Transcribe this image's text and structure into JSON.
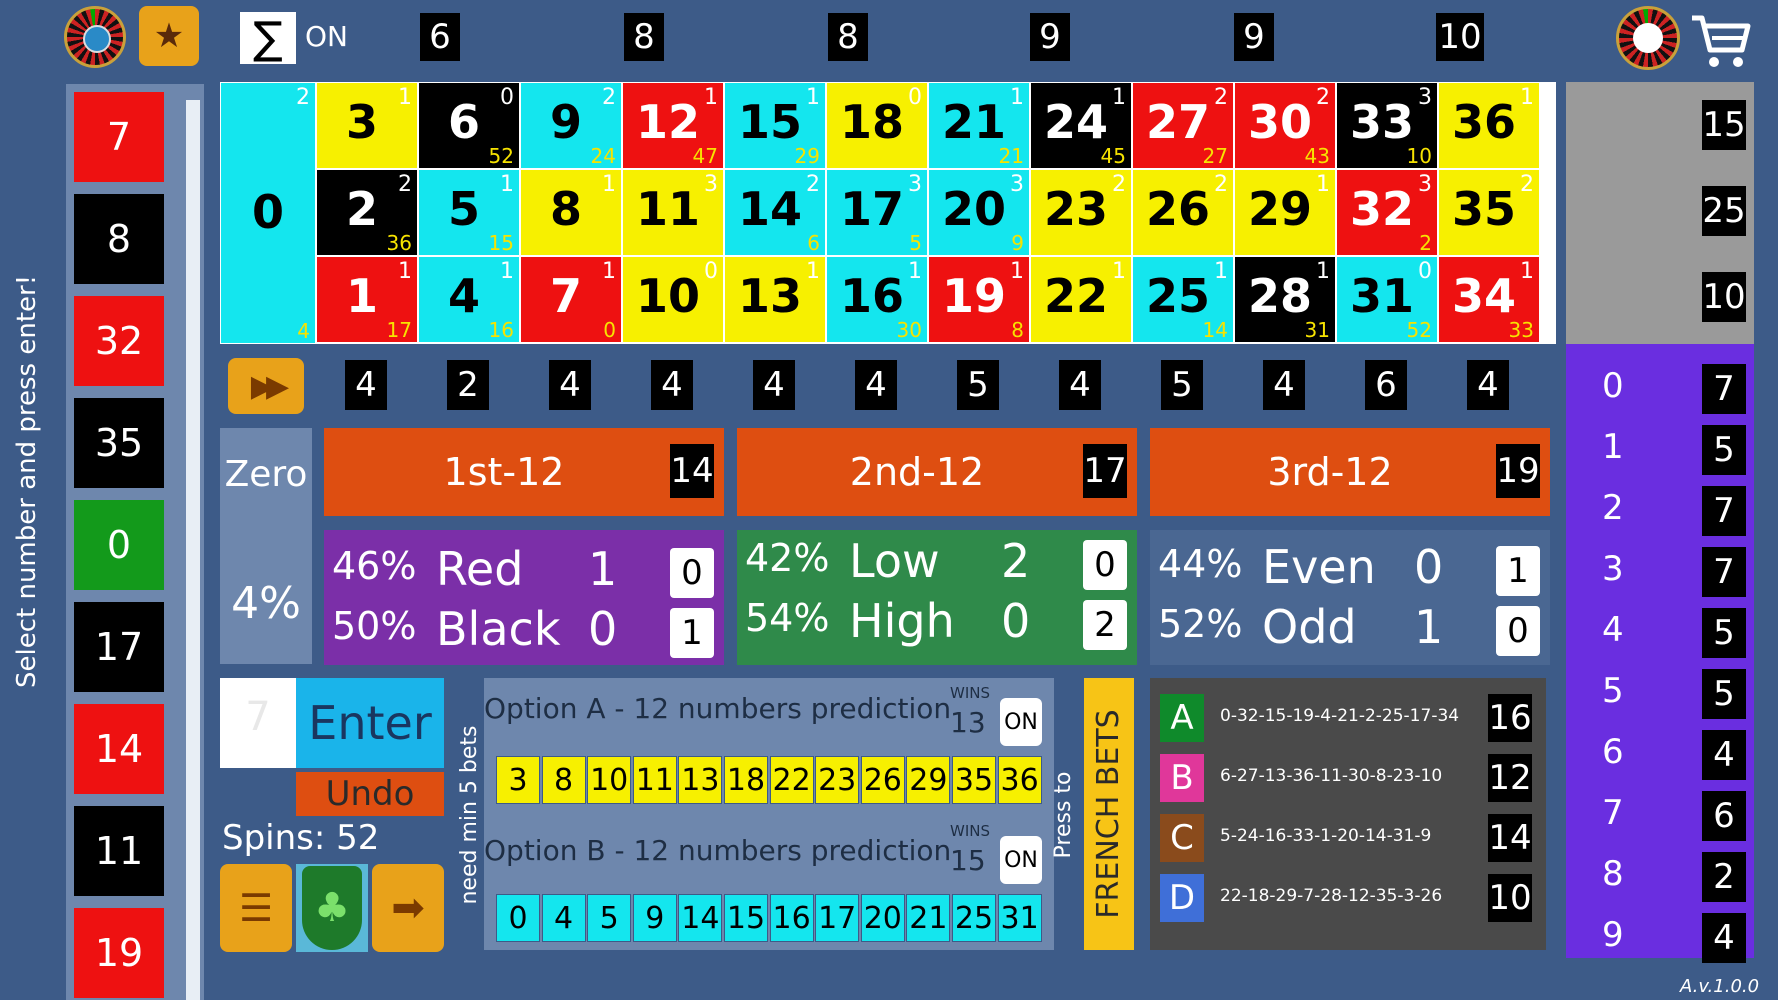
{
  "side_instruction": "Select number and press enter!",
  "history": [
    {
      "n": "7",
      "c": "red"
    },
    {
      "n": "8",
      "c": "black"
    },
    {
      "n": "32",
      "c": "red"
    },
    {
      "n": "35",
      "c": "black"
    },
    {
      "n": "0",
      "c": "green"
    },
    {
      "n": "17",
      "c": "black"
    },
    {
      "n": "14",
      "c": "red"
    },
    {
      "n": "11",
      "c": "black"
    },
    {
      "n": "19",
      "c": "red"
    }
  ],
  "topbar": {
    "sum_symbol": "∑",
    "sum_state": "ON",
    "counts": [
      "6",
      "8",
      "8",
      "9",
      "9",
      "10"
    ]
  },
  "grid": {
    "zero": {
      "n": "0",
      "sup": "2",
      "sub": "4"
    },
    "rows": [
      [
        {
          "n": "3",
          "sup": "1",
          "sub": "",
          "c": "yellow"
        },
        {
          "n": "6",
          "sup": "0",
          "sub": "52",
          "c": "black"
        },
        {
          "n": "9",
          "sup": "2",
          "sub": "24",
          "c": "cyan"
        },
        {
          "n": "12",
          "sup": "1",
          "sub": "47",
          "c": "red"
        },
        {
          "n": "15",
          "sup": "1",
          "sub": "29",
          "c": "cyan"
        },
        {
          "n": "18",
          "sup": "0",
          "sub": "",
          "c": "yellow"
        },
        {
          "n": "21",
          "sup": "1",
          "sub": "21",
          "c": "cyan"
        },
        {
          "n": "24",
          "sup": "1",
          "sub": "45",
          "c": "black"
        },
        {
          "n": "27",
          "sup": "2",
          "sub": "27",
          "c": "red"
        },
        {
          "n": "30",
          "sup": "2",
          "sub": "43",
          "c": "red"
        },
        {
          "n": "33",
          "sup": "3",
          "sub": "10",
          "c": "black"
        },
        {
          "n": "36",
          "sup": "1",
          "sub": "",
          "c": "yellow"
        }
      ],
      [
        {
          "n": "2",
          "sup": "2",
          "sub": "36",
          "c": "black"
        },
        {
          "n": "5",
          "sup": "1",
          "sub": "15",
          "c": "cyan"
        },
        {
          "n": "8",
          "sup": "1",
          "sub": "",
          "c": "yellow"
        },
        {
          "n": "11",
          "sup": "3",
          "sub": "",
          "c": "yellow"
        },
        {
          "n": "14",
          "sup": "2",
          "sub": "6",
          "c": "cyan"
        },
        {
          "n": "17",
          "sup": "3",
          "sub": "5",
          "c": "cyan"
        },
        {
          "n": "20",
          "sup": "3",
          "sub": "9",
          "c": "cyan"
        },
        {
          "n": "23",
          "sup": "2",
          "sub": "",
          "c": "yellow"
        },
        {
          "n": "26",
          "sup": "2",
          "sub": "",
          "c": "yellow"
        },
        {
          "n": "29",
          "sup": "1",
          "sub": "",
          "c": "yellow"
        },
        {
          "n": "32",
          "sup": "3",
          "sub": "2",
          "c": "red"
        },
        {
          "n": "35",
          "sup": "2",
          "sub": "",
          "c": "yellow"
        }
      ],
      [
        {
          "n": "1",
          "sup": "1",
          "sub": "17",
          "c": "red"
        },
        {
          "n": "4",
          "sup": "1",
          "sub": "16",
          "c": "cyan"
        },
        {
          "n": "7",
          "sup": "1",
          "sub": "0",
          "c": "red"
        },
        {
          "n": "10",
          "sup": "0",
          "sub": "",
          "c": "yellow"
        },
        {
          "n": "13",
          "sup": "1",
          "sub": "",
          "c": "yellow"
        },
        {
          "n": "16",
          "sup": "1",
          "sub": "30",
          "c": "cyan"
        },
        {
          "n": "19",
          "sup": "1",
          "sub": "8",
          "c": "red"
        },
        {
          "n": "22",
          "sup": "1",
          "sub": "",
          "c": "yellow"
        },
        {
          "n": "25",
          "sup": "1",
          "sub": "14",
          "c": "cyan"
        },
        {
          "n": "28",
          "sup": "1",
          "sub": "31",
          "c": "black"
        },
        {
          "n": "31",
          "sup": "0",
          "sub": "52",
          "c": "cyan"
        },
        {
          "n": "34",
          "sup": "1",
          "sub": "33",
          "c": "red"
        }
      ]
    ],
    "column_counts": [
      "15",
      "25",
      "10"
    ]
  },
  "street_counts": [
    "4",
    "2",
    "4",
    "4",
    "4",
    "4",
    "5",
    "4",
    "5",
    "4",
    "6",
    "4"
  ],
  "dozens": {
    "zero_label": "Zero",
    "zero_pct": "4%",
    "items": [
      {
        "label": "1st-12",
        "count": "14"
      },
      {
        "label": "2nd-12",
        "count": "17"
      },
      {
        "label": "3rd-12",
        "count": "19"
      }
    ]
  },
  "even_bets": [
    {
      "rows": [
        {
          "pct": "46%",
          "name": "Red",
          "val": "1",
          "box": "0"
        },
        {
          "pct": "50%",
          "name": "Black",
          "val": "0",
          "box": "1"
        }
      ]
    },
    {
      "rows": [
        {
          "pct": "42%",
          "name": "Low",
          "val": "2",
          "box": "0"
        },
        {
          "pct": "54%",
          "name": "High",
          "val": "0",
          "box": "2"
        }
      ]
    },
    {
      "rows": [
        {
          "pct": "44%",
          "name": "Even",
          "val": "0",
          "box": "1"
        },
        {
          "pct": "52%",
          "name": "Odd",
          "val": "1",
          "box": "0"
        }
      ]
    }
  ],
  "entry": {
    "input_value": "7",
    "enter_label": "Enter",
    "undo_label": "Undo",
    "spins_label": "Spins: 52"
  },
  "min_bets_note": "need min 5 bets",
  "options": [
    {
      "title": "Option A - 12 numbers prediction",
      "wins_label": "WINS",
      "wins": "13",
      "state": "ON",
      "numbers": [
        "3",
        "8",
        "10",
        "11",
        "13",
        "18",
        "22",
        "23",
        "26",
        "29",
        "35",
        "36"
      ],
      "color": "yellow"
    },
    {
      "title": "Option B - 12 numbers prediction",
      "wins_label": "WINS",
      "wins": "15",
      "state": "ON",
      "numbers": [
        "0",
        "4",
        "5",
        "9",
        "14",
        "15",
        "16",
        "17",
        "20",
        "21",
        "25",
        "31"
      ],
      "color": "cyan"
    }
  ],
  "french": {
    "press_to": "Press to",
    "button_label": "FRENCH BETS",
    "rows": [
      {
        "letter": "A",
        "seq": "0-32-15-19-4-21-2-25-17-34",
        "count": "16",
        "color": "#0f8a2b"
      },
      {
        "letter": "B",
        "seq": "6-27-13-36-11-30-8-23-10",
        "count": "12",
        "color": "#e0379a"
      },
      {
        "letter": "C",
        "seq": "5-24-16-33-1-20-14-31-9",
        "count": "14",
        "color": "#8a4b1c"
      },
      {
        "letter": "D",
        "seq": "22-18-29-7-28-12-35-3-26",
        "count": "10",
        "color": "#3f6fd8"
      }
    ]
  },
  "digit_stats": [
    {
      "d": "0",
      "n": "7"
    },
    {
      "d": "1",
      "n": "5"
    },
    {
      "d": "2",
      "n": "7"
    },
    {
      "d": "3",
      "n": "7"
    },
    {
      "d": "4",
      "n": "5"
    },
    {
      "d": "5",
      "n": "5"
    },
    {
      "d": "6",
      "n": "4"
    },
    {
      "d": "7",
      "n": "6"
    },
    {
      "d": "8",
      "n": "2"
    },
    {
      "d": "9",
      "n": "4"
    }
  ],
  "version": "A.v.1.0.0",
  "colors": {
    "background": "#3d5b88",
    "accent_orange": "#de4e11",
    "purple": "#7b2fa8",
    "green": "#2f8a4a",
    "right_panel": "#6a2ee0"
  }
}
